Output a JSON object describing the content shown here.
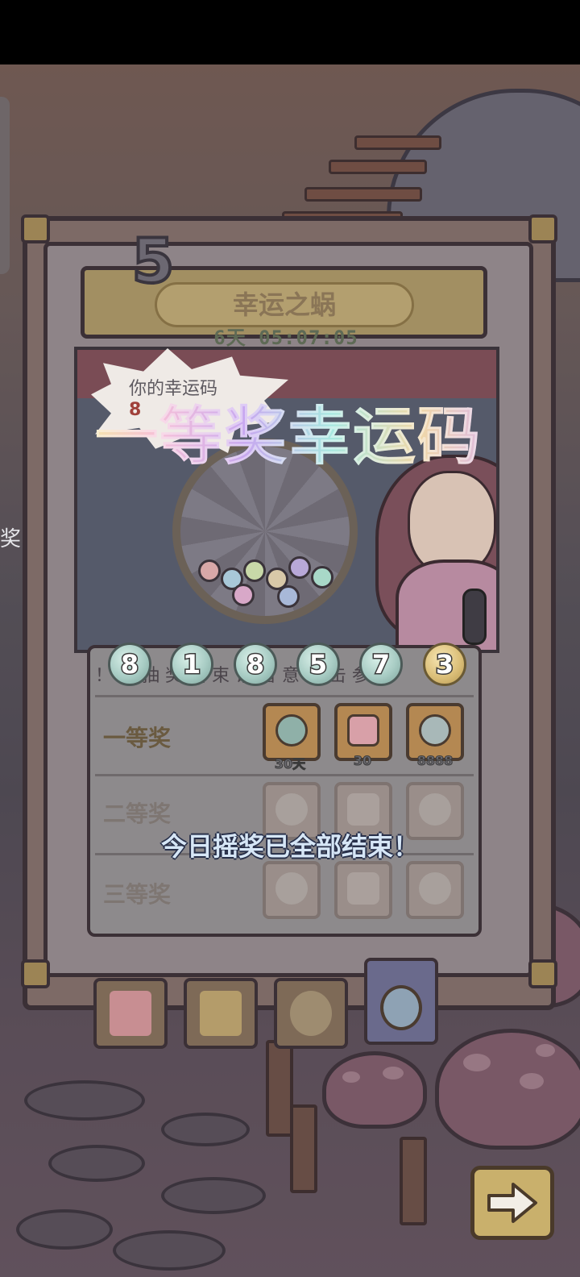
{
  "event": {
    "round_number": "5",
    "title": "幸运之蜗",
    "countdown": "6天 05:07:05"
  },
  "lucky_code": {
    "label": "你的幸运码",
    "partial_behind": "8",
    "banner": "一等奖幸运码",
    "digits": [
      "8",
      "1",
      "8",
      "5",
      "7",
      "3"
    ]
  },
  "panel": {
    "hint": "！ 天 抽 奖 结 束 请 留 意 点 击 参 加"
  },
  "tiers": [
    {
      "label": "一等奖",
      "state": "active",
      "prizes": [
        {
          "icon": "clock-badge-icon",
          "caption": "30天"
        },
        {
          "icon": "cake-icon",
          "caption": "30"
        },
        {
          "icon": "snail-ghost-icon",
          "caption": "8888"
        }
      ]
    },
    {
      "label": "二等奖",
      "state": "dim",
      "prizes": [
        {
          "icon": "clock-badge-icon",
          "caption": ""
        },
        {
          "icon": "cake-icon",
          "caption": ""
        },
        {
          "icon": "snail-ghost-icon",
          "caption": ""
        }
      ]
    },
    {
      "label": "三等奖",
      "state": "dim",
      "prizes": [
        {
          "icon": "clock-badge-icon",
          "caption": ""
        },
        {
          "icon": "cake-icon",
          "caption": ""
        },
        {
          "icon": "snail-ghost-icon",
          "caption": ""
        }
      ]
    }
  ],
  "status_message": "今日摇奖已全部结束！",
  "side_text": "奖！",
  "tabs": [
    {
      "icon": "cake-icon",
      "active": false
    },
    {
      "icon": "card-icon",
      "active": false
    },
    {
      "icon": "lollipop-icon",
      "active": false
    },
    {
      "icon": "lottery-ball-icon",
      "active": true
    }
  ],
  "next_button": {
    "icon": "right-arrow-icon"
  },
  "colors": {
    "frame": "#7d6a66",
    "gold_accent": "#b48852",
    "ball_teal": "#a8ccc4",
    "ball_gold": "#dcc07a"
  }
}
